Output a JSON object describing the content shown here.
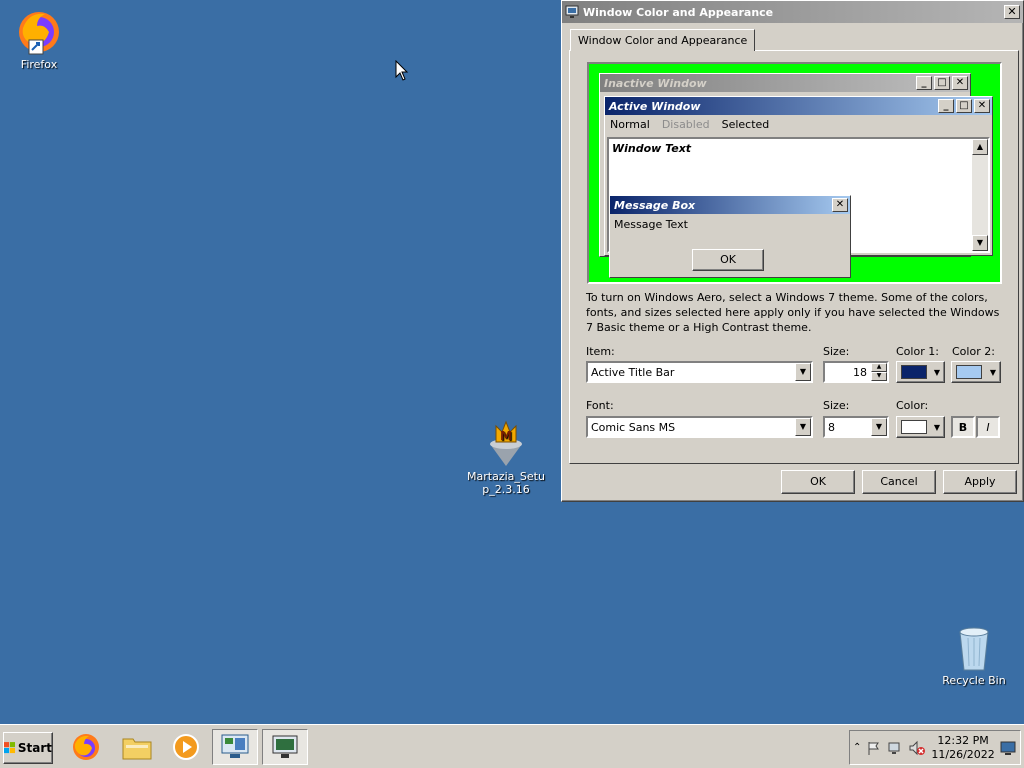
{
  "desktop": {
    "icons": [
      {
        "label": "Firefox"
      },
      {
        "label": "Martazia_Setup_2.3.16"
      },
      {
        "label": "Recycle Bin"
      }
    ]
  },
  "window": {
    "title": "Window Color and Appearance",
    "close_glyph": "✕",
    "tab_label": "Window Color and Appearance",
    "preview": {
      "inactive_title": "Inactive Window",
      "active_title": "Active Window",
      "menu_normal": "Normal",
      "menu_disabled": "Disabled",
      "menu_selected": "Selected",
      "window_text": "Window Text",
      "msgbox_title": "Message Box",
      "msgbox_text": "Message Text",
      "msgbox_ok": "OK",
      "bg_color": "#00ff00"
    },
    "info_text": "To turn on Windows Aero, select a Windows 7 theme.  Some of the colors, fonts, and sizes selected here apply only if you have selected the Windows 7 Basic theme or a High Contrast theme.",
    "item_label": "Item:",
    "item_value": "Active Title Bar",
    "size1_label": "Size:",
    "size1_value": "18",
    "color1_label": "Color 1:",
    "color1": "#0a246a",
    "color2_label": "Color 2:",
    "color2": "#a6caf0",
    "font_label": "Font:",
    "font_value": "Comic Sans MS",
    "size2_label": "Size:",
    "size2_value": "8",
    "color3_label": "Color:",
    "color3": "#ffffff",
    "bold_label": "B",
    "italic_label": "I",
    "ok_label": "OK",
    "cancel_label": "Cancel",
    "apply_label": "Apply"
  },
  "taskbar": {
    "start_label": "Start",
    "clock_time": "12:32 PM",
    "clock_date": "11/26/2022"
  }
}
